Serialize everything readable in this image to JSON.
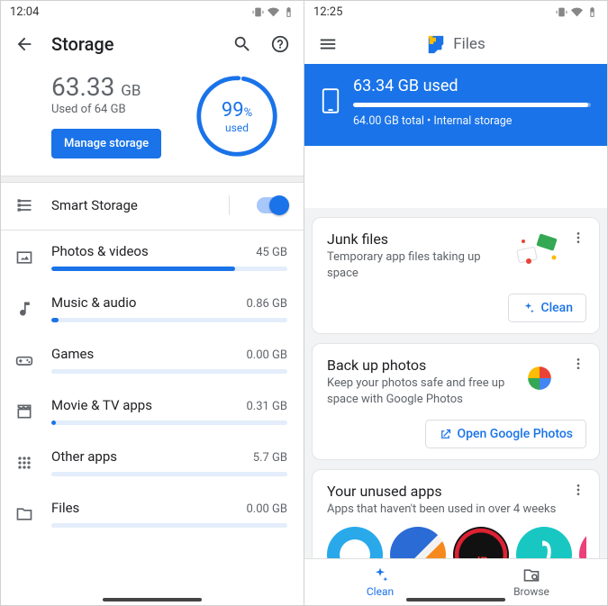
{
  "left": {
    "time": "12:04",
    "title": "Storage",
    "used_value": "63.33",
    "used_unit": "GB",
    "used_sub": "Used of 64 GB",
    "manage_label": "Manage storage",
    "pct_value": "99",
    "pct_suffix": "%",
    "pct_label": "used",
    "smart": {
      "label": "Smart Storage",
      "on": true
    },
    "categories": [
      {
        "icon": "photos",
        "label": "Photos & videos",
        "value": "45 GB",
        "percent": 78
      },
      {
        "icon": "music",
        "label": "Music & audio",
        "value": "0.86 GB",
        "percent": 3
      },
      {
        "icon": "games",
        "label": "Games",
        "value": "0.00 GB",
        "percent": 0
      },
      {
        "icon": "movie",
        "label": "Movie & TV apps",
        "value": "0.31 GB",
        "percent": 2
      },
      {
        "icon": "apps",
        "label": "Other apps",
        "value": "5.7 GB",
        "percent": 0
      },
      {
        "icon": "files",
        "label": "Files",
        "value": "0.00 GB",
        "percent": 0
      }
    ]
  },
  "right": {
    "time": "12:25",
    "brand": "Files",
    "used_heading": "63.34 GB used",
    "used_percent": 99,
    "sub": "64.00 GB total • Internal storage",
    "cards": {
      "junk": {
        "title": "Junk files",
        "desc": "Temporary app files taking up space",
        "btn": "Clean"
      },
      "backup": {
        "title": "Back up photos",
        "desc": "Keep your photos safe and free up space with Google Photos",
        "btn": "Open Google Photos"
      },
      "unused": {
        "title": "Your unused apps",
        "desc": "Apps that haven't been used in over 4 weeks"
      }
    },
    "nav": {
      "clean": "Clean",
      "browse": "Browse"
    }
  }
}
